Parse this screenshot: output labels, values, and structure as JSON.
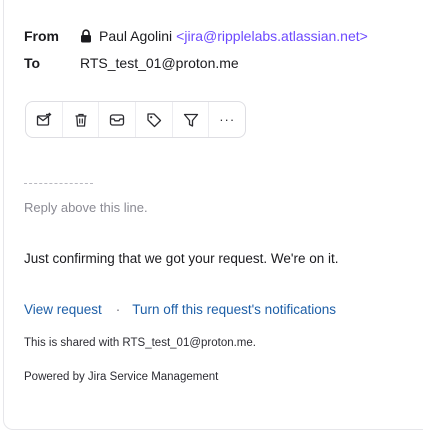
{
  "header": {
    "from_label": "From",
    "to_label": "To",
    "sender_name": "Paul Agolini",
    "sender_email": "<jira@ripplelabs.atlassian.net>",
    "recipient": "RTS_test_01@proton.me"
  },
  "toolbar": {
    "buttons": [
      {
        "icon": "envelope-move-icon"
      },
      {
        "icon": "trash-icon"
      },
      {
        "icon": "archive-icon"
      },
      {
        "icon": "tag-icon"
      },
      {
        "icon": "filter-icon"
      },
      {
        "icon": "more-icon",
        "text": "···"
      }
    ]
  },
  "message": {
    "divider": "----------",
    "reply_above": "Reply above this line.",
    "body": "Just confirming that we got your request. We're on it.",
    "view_request": "View request",
    "separator": "·",
    "turn_off": "Turn off this request's notifications",
    "shared": "This is shared with RTS_test_01@proton.me.",
    "powered": "Powered by Jira Service Management"
  },
  "colors": {
    "accent": "#6d4aff",
    "link": "#1d5fa8",
    "muted": "#8a8a93"
  }
}
